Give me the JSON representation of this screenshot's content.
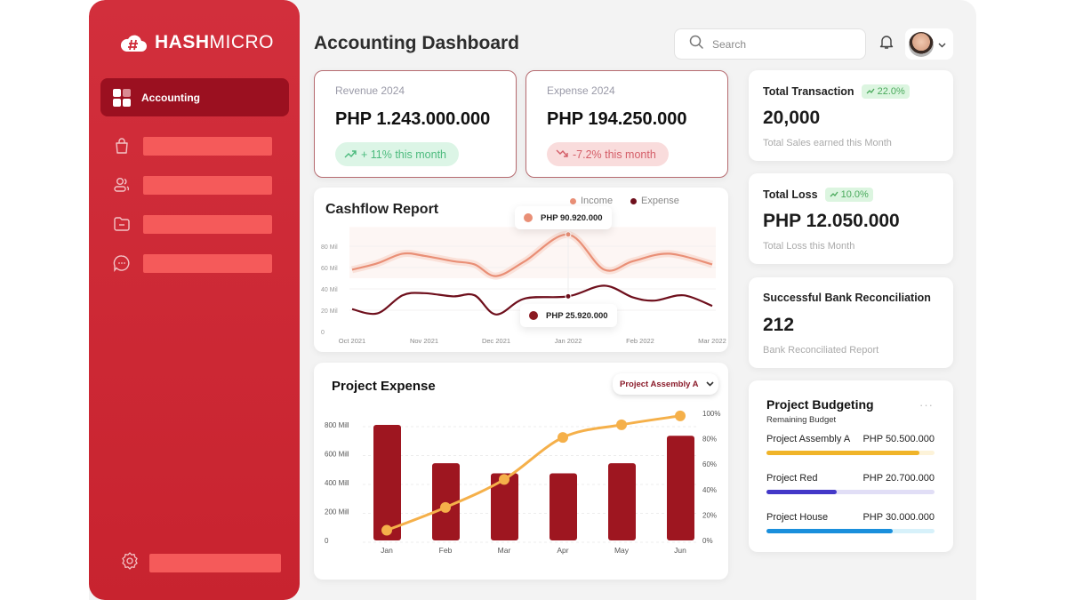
{
  "brand": {
    "logo_bold": "HASH",
    "logo_thin": "MICRO"
  },
  "sidebar": {
    "active_item": {
      "label": "Accounting",
      "icon": "grid-icon"
    },
    "items": [
      {
        "icon": "shopping-bag-icon"
      },
      {
        "icon": "users-icon"
      },
      {
        "icon": "folder-icon"
      },
      {
        "icon": "chat-bubble-icon"
      }
    ],
    "footer_item": {
      "icon": "gear-icon"
    }
  },
  "header": {
    "title": "Accounting Dashboard",
    "search": {
      "placeholder": "Search",
      "value": ""
    },
    "notification_icon": "bell-icon",
    "profile_icon": "chevron-down-icon"
  },
  "kpis": [
    {
      "label": "Revenue 2024",
      "value": "PHP 1.243.000.000",
      "trend": "+ 11% this month",
      "direction": "up"
    },
    {
      "label": "Expense 2024",
      "value": "PHP 194.250.000",
      "trend": "-7.2% this month",
      "direction": "down"
    }
  ],
  "cashflow": {
    "title": "Cashflow Report",
    "legend": [
      {
        "name": "Income",
        "color": "#e98f76"
      },
      {
        "name": "Expense",
        "color": "#6e0f1c"
      }
    ],
    "tooltips": {
      "income": "PHP 90.920.000",
      "expense": "PHP 25.920.000"
    }
  },
  "project_expense": {
    "title": "Project Expense",
    "dropdown": "Project Assembly A"
  },
  "stats": [
    {
      "title": "Total Transaction",
      "badge": "22.0%",
      "value": "20,000",
      "subtitle": "Total Sales earned this Month"
    },
    {
      "title": "Total Loss",
      "badge": "10.0%",
      "value": "PHP 12.050.000",
      "subtitle": "Total Loss this Month"
    },
    {
      "title": "Successful Bank Reconciliation",
      "badge": null,
      "value": "212",
      "subtitle": "Bank Reconciliated Report"
    }
  ],
  "budgeting": {
    "title": "Project Budgeting",
    "subtitle": "Remaining Budget",
    "more": "···",
    "projects": [
      {
        "name": "Project Assembly A",
        "amount": "PHP 50.500.000",
        "progress": 0.91,
        "color": "#f0b429",
        "track": "#fdf3d9"
      },
      {
        "name": "Project Red",
        "amount": "PHP 20.700.000",
        "progress": 0.42,
        "color": "#4338c8",
        "track": "#e1def6"
      },
      {
        "name": "Project House",
        "amount": "PHP 30.000.000",
        "progress": 0.75,
        "color": "#1a8fdc",
        "track": "#d7f1fa"
      }
    ]
  },
  "chart_data": [
    {
      "type": "line",
      "title": "Cashflow Report",
      "xlabel": "",
      "ylabel": "",
      "x": [
        "Oct 2021",
        "Nov 2021",
        "Dec 2021",
        "Jan 2022",
        "Feb 2022",
        "Mar 2022"
      ],
      "yticks": [
        "0",
        "20 Mil",
        "40 Mil",
        "60 Mil",
        "80 Mil"
      ],
      "ylim": [
        0,
        100
      ],
      "grid": true,
      "legend": "top-right",
      "series": [
        {
          "name": "Income",
          "color": "#e98f76",
          "points": [
            [
              0,
              58
            ],
            [
              0.35,
              64
            ],
            [
              0.7,
              73
            ],
            [
              1.0,
              71
            ],
            [
              1.4,
              66
            ],
            [
              1.7,
              63
            ],
            [
              2.0,
              52
            ],
            [
              2.4,
              66
            ],
            [
              3.0,
              91
            ],
            [
              3.5,
              58
            ],
            [
              3.9,
              66
            ],
            [
              4.4,
              73
            ],
            [
              5.0,
              63
            ]
          ]
        },
        {
          "name": "Expense",
          "color": "#6e0f1c",
          "points": [
            [
              0,
              21
            ],
            [
              0.35,
              17
            ],
            [
              0.7,
              34
            ],
            [
              1.0,
              36
            ],
            [
              1.4,
              33
            ],
            [
              1.7,
              34
            ],
            [
              2.0,
              16
            ],
            [
              2.4,
              31
            ],
            [
              3.0,
              33
            ],
            [
              3.5,
              43
            ],
            [
              3.9,
              32
            ],
            [
              4.2,
              29
            ],
            [
              4.6,
              34
            ],
            [
              5.0,
              24
            ]
          ]
        }
      ],
      "annotations": [
        {
          "x": "Jan 2022",
          "series": "Income",
          "text": "PHP 90.920.000"
        },
        {
          "x": "Jan 2022",
          "series": "Expense",
          "text": "PHP 25.920.000"
        }
      ]
    },
    {
      "type": "bar",
      "title": "Project Expense",
      "categories": [
        "Jan",
        "Feb",
        "Mar",
        "Apr",
        "May",
        "Jun"
      ],
      "yticks_left": [
        "0",
        "200 Mill",
        "400 Mill",
        "600 Mill",
        "800 Mill"
      ],
      "yticks_right": [
        "0%",
        "20%",
        "40%",
        "60%",
        "80%",
        "100%"
      ],
      "ylim": [
        0,
        800
      ],
      "ylim_right": [
        0,
        100
      ],
      "grid": true,
      "series": [
        {
          "name": "Expense",
          "type": "bar",
          "color": "#9e1620",
          "values": [
            800,
            535,
            465,
            465,
            535,
            725
          ]
        },
        {
          "name": "Cumulative %",
          "type": "line",
          "color": "#f5b04a",
          "values": [
            8,
            26,
            48,
            81,
            91,
            98
          ]
        }
      ]
    }
  ]
}
